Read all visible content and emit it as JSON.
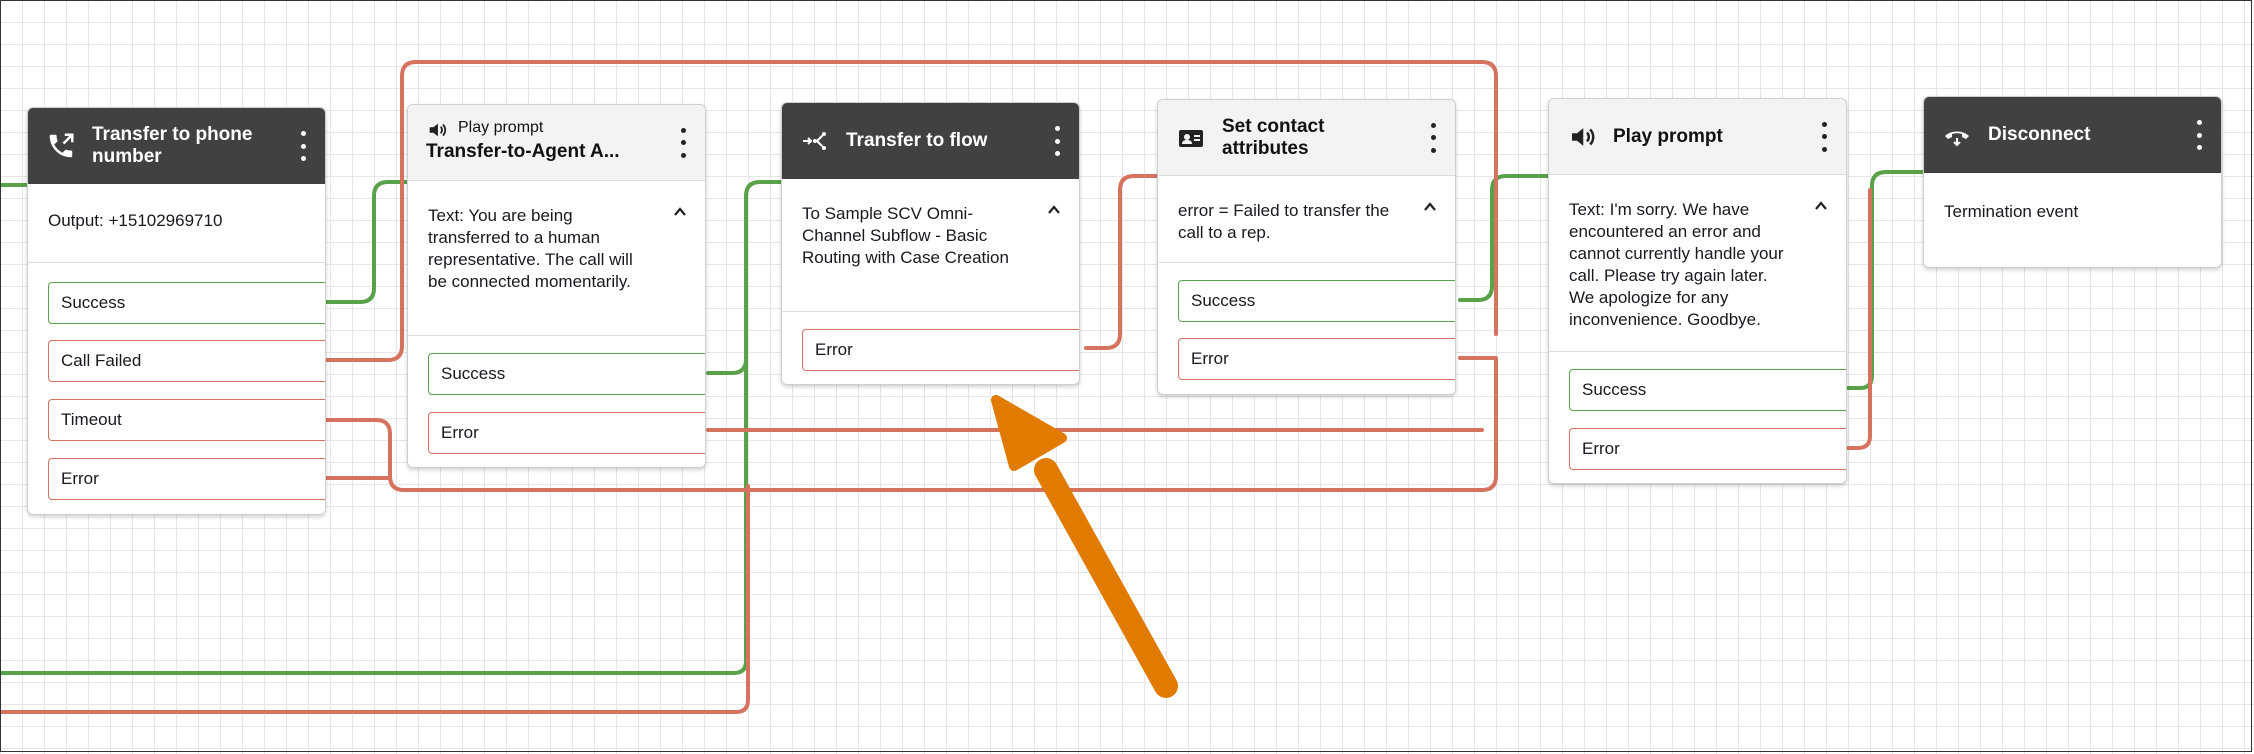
{
  "blocks": {
    "transfer_phone": {
      "title": "Transfer to phone number",
      "body": "Output: +15102969710",
      "branches": [
        "Success",
        "Call Failed",
        "Timeout",
        "Error"
      ]
    },
    "play_prompt_1": {
      "subtitle": "Play prompt",
      "title": "Transfer-to-Agent A...",
      "body": "Text: You are being transferred to a human representative. The call will be connected momentarily.",
      "branches": [
        "Success",
        "Error"
      ]
    },
    "transfer_flow": {
      "title": "Transfer to flow",
      "body": "To Sample SCV Omni-Channel Subflow - Basic Routing with Case Creation",
      "branches": [
        "Error"
      ]
    },
    "set_attributes": {
      "title": "Set contact attributes",
      "body": "error = Failed to transfer the call to a rep.",
      "branches": [
        "Success",
        "Error"
      ]
    },
    "play_prompt_2": {
      "title": "Play prompt",
      "body": "Text: I'm sorry. We have encountered an error and cannot currently handle your call. Please try again later. We apologize for any inconvenience. Goodbye.",
      "branches": [
        "Success",
        "Error"
      ]
    },
    "disconnect": {
      "title": "Disconnect",
      "body": "Termination event"
    }
  },
  "colors": {
    "success_wire": "#5aa24a",
    "error_wire": "#d5735f",
    "header_dark": "#414141",
    "header_light": "#f2f3f3",
    "annotation_arrow": "#e07b00"
  },
  "icons": {
    "transfer_phone": "phone-transfer-icon",
    "play_prompt": "speaker-icon",
    "transfer_flow": "flow-transfer-icon",
    "set_attributes": "contact-card-icon",
    "disconnect": "hang-up-icon"
  }
}
